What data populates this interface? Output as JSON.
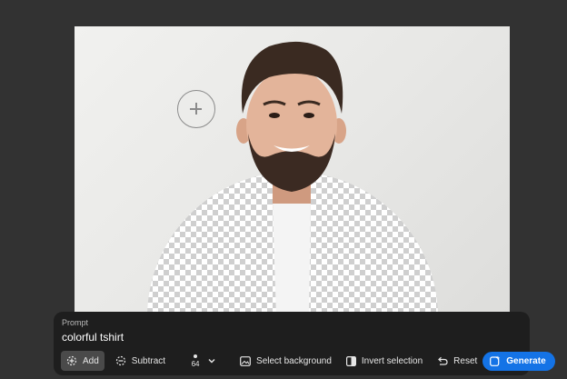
{
  "prompt": {
    "label": "Prompt",
    "value": "colorful tshirt"
  },
  "toolbar": {
    "add_label": "Add",
    "subtract_label": "Subtract",
    "brush_size": "64",
    "select_background_label": "Select background",
    "invert_selection_label": "Invert selection",
    "reset_label": "Reset",
    "generate_label": "Generate"
  },
  "icons": {
    "add": "add-brush-icon",
    "subtract": "subtract-brush-icon",
    "brush_size": "brush-size-dot-icon",
    "dropdown": "chevron-down-icon",
    "select_background": "image-select-icon",
    "invert": "invert-selection-icon",
    "reset": "undo-icon",
    "generate": "generate-sparkle-icon"
  },
  "colors": {
    "app_background": "#323232",
    "panel_background": "#1e1e1e",
    "accent": "#1473e6",
    "active_tool": "#4a4a4a"
  }
}
